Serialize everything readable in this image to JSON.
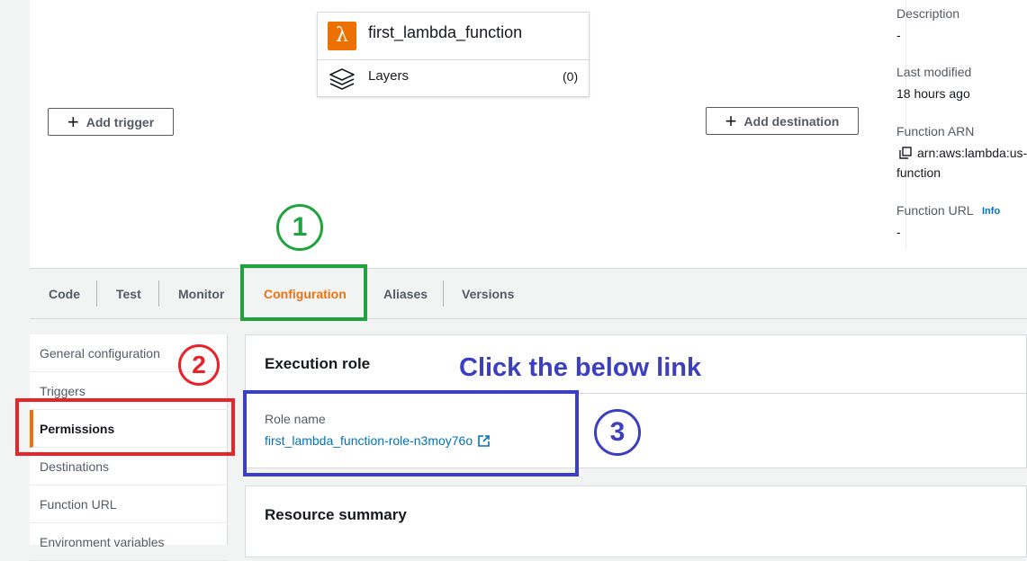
{
  "function_card": {
    "icon": "lambda-icon",
    "name": "first_lambda_function",
    "layers_icon": "layers-icon",
    "layers_label": "Layers",
    "layers_count": "(0)"
  },
  "buttons": {
    "add_trigger": "Add trigger",
    "add_destination": "Add destination"
  },
  "meta": {
    "description_label": "Description",
    "description_value": "-",
    "last_modified_label": "Last modified",
    "last_modified_value": "18 hours ago",
    "arn_label": "Function ARN",
    "arn_value_line1": "arn:aws:lambda:us-",
    "arn_value_line2": "function",
    "url_label": "Function URL",
    "url_info": "Info",
    "url_value": "-"
  },
  "annotations": {
    "step1": "1",
    "step2": "2",
    "step3": "3",
    "instruction": "Click the below link",
    "color_step1": "#1fa33c",
    "color_step2": "#e8232a",
    "color_step3": "#3b3fc0"
  },
  "tabs": [
    "Code",
    "Test",
    "Monitor",
    "Configuration",
    "Aliases",
    "Versions"
  ],
  "active_tab": "Configuration",
  "sidenav": [
    "General configuration",
    "Triggers",
    "Permissions",
    "Destinations",
    "Function URL",
    "Environment variables"
  ],
  "active_nav": "Permissions",
  "execution_role": {
    "title": "Execution role",
    "role_name_label": "Role name",
    "role_name_link": "first_lambda_function-role-n3moy76o",
    "link_icon": "external-link-icon"
  },
  "resource_summary": {
    "title": "Resource summary"
  },
  "colors": {
    "accent_orange": "#ec7211",
    "link_blue": "#0073bb"
  }
}
